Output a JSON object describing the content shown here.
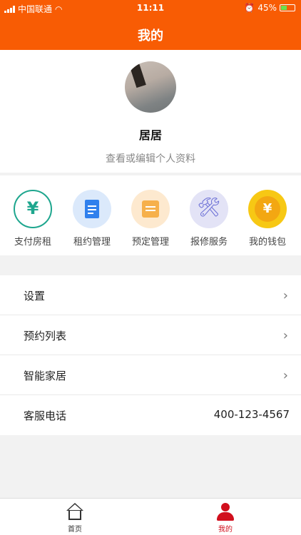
{
  "status": {
    "carrier": "中国联通",
    "time": "11:11",
    "battery": "45%"
  },
  "header": {
    "title": "我的"
  },
  "profile": {
    "name": "居居",
    "edit_link": "查看或编辑个人资料"
  },
  "quick_actions": [
    {
      "label": "支付房租",
      "icon": "yuan-circle-icon",
      "symbol": "¥"
    },
    {
      "label": "租约管理",
      "icon": "document-icon"
    },
    {
      "label": "预定管理",
      "icon": "calendar-icon"
    },
    {
      "label": "报修服务",
      "icon": "tools-icon",
      "symbol": "🛠"
    },
    {
      "label": "我的钱包",
      "icon": "coin-icon",
      "symbol": "¥"
    }
  ],
  "menu": [
    {
      "label": "设置",
      "chevron": "›"
    },
    {
      "label": "预约列表",
      "chevron": "›"
    },
    {
      "label": "智能家居",
      "chevron": "›"
    },
    {
      "label": "客服电话",
      "value": "400-123-4567"
    }
  ],
  "tabbar": [
    {
      "label": "首页",
      "active": false
    },
    {
      "label": "我的",
      "active": true
    }
  ],
  "colors": {
    "brand": "#f85c04",
    "active_tab": "#d10f1d"
  }
}
